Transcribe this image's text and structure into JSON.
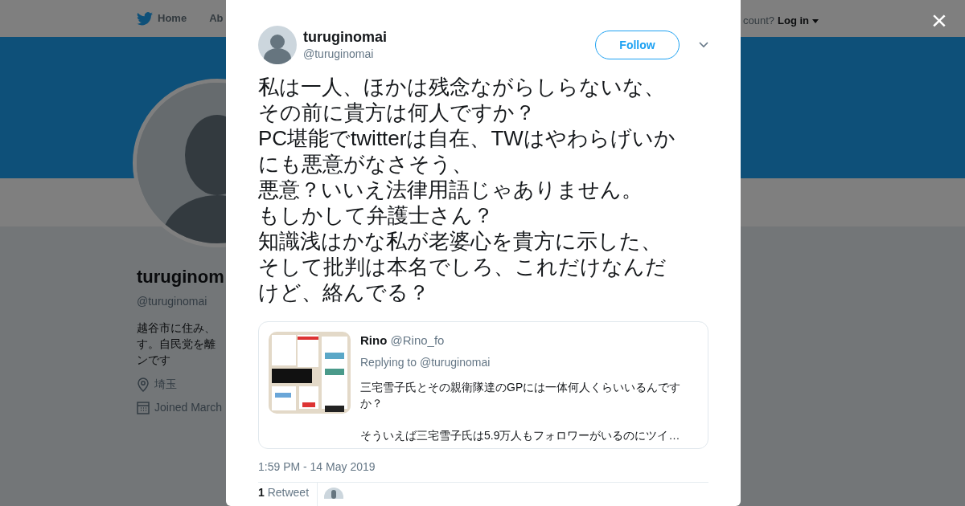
{
  "nav": {
    "items": [
      {
        "label": "Home",
        "kind": "home"
      },
      {
        "label": "Ab",
        "kind": "plain"
      }
    ],
    "account_prompt": "count?",
    "login": "Log in"
  },
  "profile": {
    "name": "turuginom",
    "handle": "@turuginomai",
    "bio_lines": [
      "越谷市に住み、",
      "す。自民党を離",
      "ンです"
    ],
    "location": "埼玉",
    "joined": "Joined March"
  },
  "tweet": {
    "author": {
      "name": "turuginomai",
      "handle": "@turuginomai"
    },
    "follow_label": "Follow",
    "text_lines": [
      "私は一人、ほかは残念ながらしらないな、",
      "その前に貴方は何人ですか？",
      "PC堪能でtwitterは自在、TWはやわらげいか",
      "にも悪意がなさそう、",
      "悪意？いいえ法律用語じゃありません。",
      "もしかして弁護士さん？",
      "知識浅はかな私が老婆心を貴方に示した、",
      "そして批判は本名でしろ、これだけなんだ",
      "けど、絡んでる？"
    ],
    "quote": {
      "name": "Rino",
      "handle": "@Rino_fo",
      "replying": "Replying to @turuginomai",
      "paragraphs": [
        "三宅雪子氏とその親衛隊達のGPには一体何人くらいいるんですか？",
        "そういえば三宅雪子氏は5.9万人もフォロワーがいるのにツイ…"
      ]
    },
    "timestamp": "1:59 PM - 14 May 2019",
    "retweets": {
      "count": "1",
      "label": "Retweet"
    }
  },
  "close": "×"
}
